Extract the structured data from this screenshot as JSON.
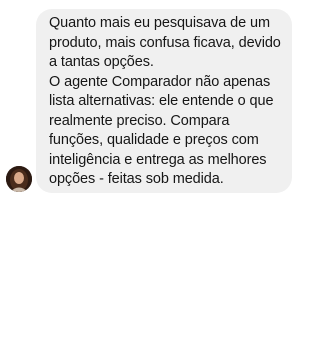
{
  "message": {
    "paragraphs": [
      "Quanto mais eu pesquisava de um produto, mais confusa ficava, devido a tantas opções.",
      "O agente Comparador não apenas lista alternativas: ele entende o que realmente preciso. Compara funções, qualidade e preços com inteligência e entrega as melhores opções - feitas sob medida."
    ]
  },
  "colors": {
    "bubble_background": "#f0f0f0",
    "text": "#161616"
  }
}
